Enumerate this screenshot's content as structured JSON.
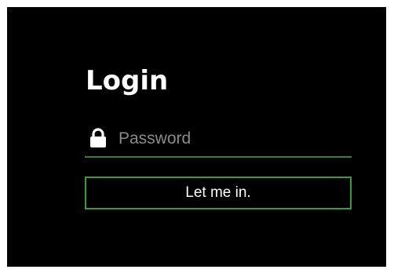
{
  "login": {
    "title": "Login",
    "password_placeholder": "Password",
    "password_value": "",
    "submit_label": "Let me in."
  },
  "icons": {
    "password_icon": "lock-icon"
  },
  "colors": {
    "background": "#000000",
    "accent": "#3c9a3c",
    "text": "#ffffff",
    "placeholder": "#8a8a8a"
  }
}
